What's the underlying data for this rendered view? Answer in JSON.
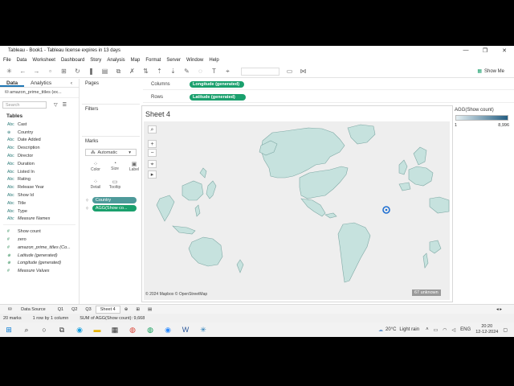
{
  "window": {
    "title": "Tableau - Book1 - Tableau license expires in 13 days"
  },
  "menu": [
    "File",
    "Data",
    "Worksheet",
    "Dashboard",
    "Story",
    "Analysis",
    "Map",
    "Format",
    "Server",
    "Window",
    "Help"
  ],
  "toolbar": {
    "show_me": "Show Me"
  },
  "data_pane": {
    "tabs": [
      "Data",
      "Analytics"
    ],
    "datasource": "amazon_prime_titles (ex...",
    "search_placeholder": "Search",
    "tables_heading": "Tables",
    "fields": [
      {
        "type": "Abc",
        "name": "Cast"
      },
      {
        "type": "⊕",
        "name": "Country"
      },
      {
        "type": "Abc",
        "name": "Date Added"
      },
      {
        "type": "Abc",
        "name": "Description"
      },
      {
        "type": "Abc",
        "name": "Director"
      },
      {
        "type": "Abc",
        "name": "Duration"
      },
      {
        "type": "Abc",
        "name": "Listed In"
      },
      {
        "type": "Abc",
        "name": "Rating"
      },
      {
        "type": "Abc",
        "name": "Release Year"
      },
      {
        "type": "Abc",
        "name": "Show Id"
      },
      {
        "type": "Abc",
        "name": "Title"
      },
      {
        "type": "Abc",
        "name": "Type"
      },
      {
        "type": "Abc",
        "name": "Measure Names"
      }
    ],
    "measures": [
      {
        "type": "#",
        "name": "Show count"
      },
      {
        "type": "#",
        "name": "zero"
      },
      {
        "type": "#",
        "name": "amazon_prime_titles (Co..."
      },
      {
        "type": "⊕",
        "name": "Latitude (generated)"
      },
      {
        "type": "⊕",
        "name": "Longitude (generated)"
      },
      {
        "type": "#",
        "name": "Measure Values"
      }
    ]
  },
  "shelves": {
    "pages_label": "Pages",
    "filters_label": "Filters",
    "marks_label": "Marks",
    "marks_type": "Automatic",
    "mark_buttons": [
      "Color",
      "Size",
      "Label",
      "Detail",
      "Tooltip"
    ],
    "mark_pills": [
      "Country",
      "AGG(Show co..."
    ],
    "columns_label": "Columns",
    "columns_pill": "Longitude (generated)",
    "rows_label": "Rows",
    "rows_pill": "Latitude (generated)"
  },
  "sheet": {
    "title": "Sheet 4",
    "credit": "© 2024 Mapbox © OpenStreetMap",
    "unknown": "67 unknown",
    "map_fill": "#c6e2de",
    "map_stroke": "#7fa9a5"
  },
  "legend": {
    "title": "AGG(Show count)",
    "min": "1",
    "max": "8,996"
  },
  "tabs": [
    "Data Source",
    "Q1",
    "Q2",
    "Q3",
    "Sheet 4"
  ],
  "status": [
    "20 marks",
    "1 row by 1 column",
    "SUM of AGG(Show count): 9,668"
  ],
  "taskbar": {
    "temp": "20°C",
    "weather": "Light rain",
    "lang": "ENG",
    "time": "20:20",
    "date": "12-12-2024"
  }
}
